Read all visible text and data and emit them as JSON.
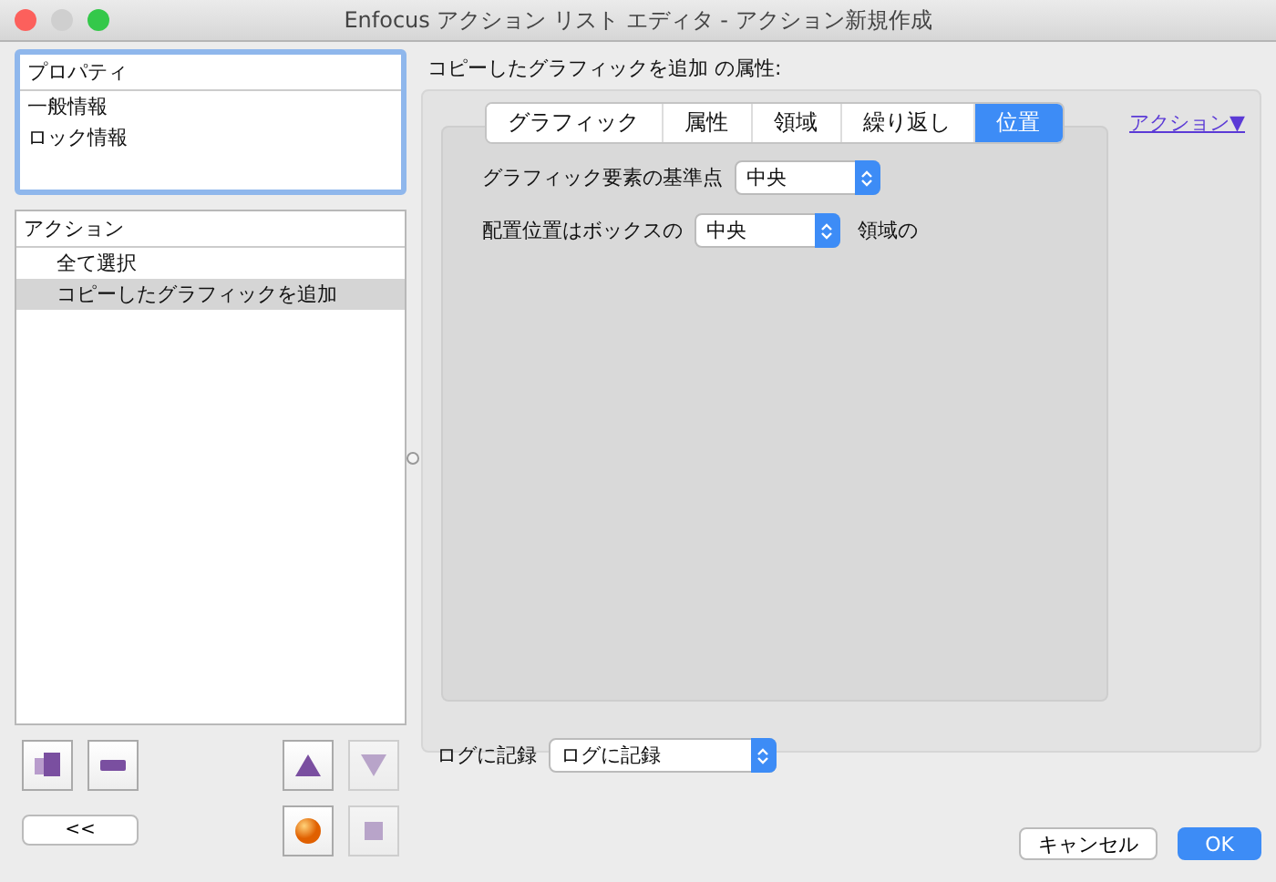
{
  "window": {
    "title": "Enfocus アクション リスト エディタ - アクション新規作成"
  },
  "properties": {
    "header": "プロパティ",
    "items": [
      {
        "label": "一般情報",
        "selected": false
      },
      {
        "label": "ロック情報",
        "selected": false
      }
    ]
  },
  "actions": {
    "header": "アクション",
    "items": [
      {
        "label": "全て選択",
        "selected": false
      },
      {
        "label": "コピーしたグラフィックを追加",
        "selected": true
      }
    ]
  },
  "action_buttons": [
    {
      "kind": "duplicate",
      "disabled": false
    },
    {
      "kind": "remove",
      "disabled": false
    },
    {
      "kind": "up",
      "disabled": false
    },
    {
      "kind": "down",
      "disabled": true
    },
    {
      "kind": "record",
      "disabled": false
    },
    {
      "kind": "stop",
      "disabled": true
    }
  ],
  "collapse_button": "<<",
  "attributes_title": "コピーしたグラフィックを追加 の属性:",
  "tabs": [
    {
      "label": "グラフィック",
      "selected": false
    },
    {
      "label": "属性",
      "selected": false
    },
    {
      "label": "領域",
      "selected": false
    },
    {
      "label": "繰り返し",
      "selected": false
    },
    {
      "label": "位置",
      "selected": true
    }
  ],
  "action_menu": "アクション▼",
  "anchor": {
    "label": "グラフィック要素の基準点",
    "value": "中央"
  },
  "placement": {
    "label": "配置位置はボックスの",
    "value": "中央",
    "suffix": "領域の"
  },
  "log": {
    "label": "ログに記録",
    "value": "ログに記録"
  },
  "buttons": {
    "cancel": "キャンセル",
    "ok": "OK"
  }
}
